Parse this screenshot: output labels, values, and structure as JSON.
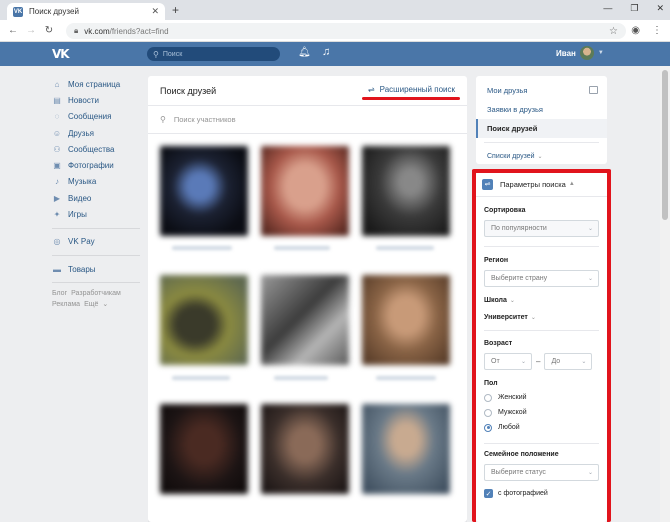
{
  "browser": {
    "tab_title": "Поиск друзей",
    "favicon_text": "VK",
    "url_host": "vk.com",
    "url_path": "/friends?act=find"
  },
  "vk_header": {
    "logo": "VK",
    "search_placeholder": "Поиск",
    "user_name": "Иван"
  },
  "left_nav": {
    "items": [
      {
        "label": "Моя страница",
        "icon": "home-icon"
      },
      {
        "label": "Новости",
        "icon": "news-icon"
      },
      {
        "label": "Сообщения",
        "icon": "messages-icon"
      },
      {
        "label": "Друзья",
        "icon": "friends-icon"
      },
      {
        "label": "Сообщества",
        "icon": "communities-icon"
      },
      {
        "label": "Фотографии",
        "icon": "photos-icon"
      },
      {
        "label": "Музыка",
        "icon": "music-icon"
      },
      {
        "label": "Видео",
        "icon": "video-icon"
      },
      {
        "label": "Игры",
        "icon": "games-icon"
      }
    ],
    "vkpay": "VK Pay",
    "goods": "Товары",
    "footer": [
      "Блог",
      "Разработчикам",
      "Реклама",
      "Ещё"
    ]
  },
  "main": {
    "title": "Поиск друзей",
    "advanced_search": "Расширенный поиск",
    "search_placeholder": "Поиск участников"
  },
  "right_menu": {
    "items": [
      "Мои друзья",
      "Заявки в друзья",
      "Поиск друзей"
    ],
    "lists": "Списки друзей"
  },
  "filters": {
    "header": "Параметры поиска",
    "sort_label": "Сортировка",
    "sort_value": "По популярности",
    "region_label": "Регион",
    "region_value": "Выберите страну",
    "school_label": "Школа",
    "university_label": "Университет",
    "age_label": "Возраст",
    "age_from": "От",
    "age_dash": "–",
    "age_to": "До",
    "gender_label": "Пол",
    "gender_options": [
      "Женский",
      "Мужской",
      "Любой"
    ],
    "gender_selected": "Любой",
    "family_label": "Семейное положение",
    "family_value": "Выберите статус",
    "with_photo": "с фотографией"
  },
  "colors": {
    "vk_blue": "#4a76a8",
    "highlight_red": "#e1141c"
  }
}
